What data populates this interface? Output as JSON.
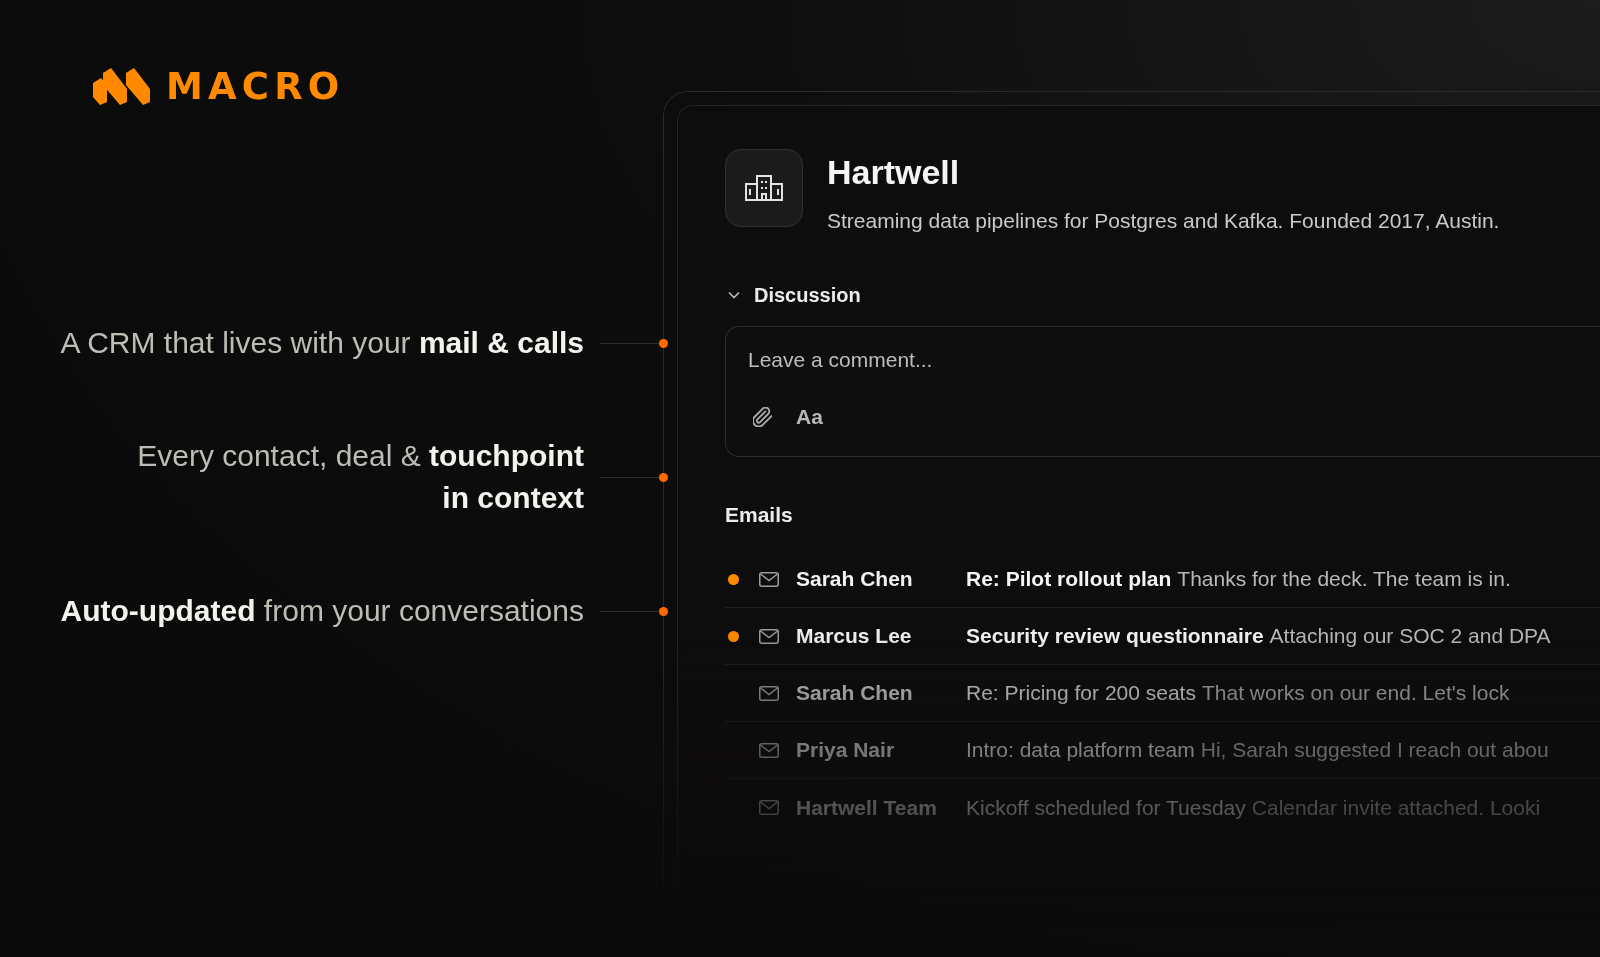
{
  "logo": {
    "text": "MACRO"
  },
  "taglines": [
    {
      "text": "A CRM that lives with your **mail & calls**"
    },
    {
      "text": "Every contact, deal & **touchpoint**\n**in context**"
    },
    {
      "text": "**Auto-updated** from your conversations"
    }
  ],
  "company": {
    "name": "Hartwell",
    "description": "Streaming data pipelines for Postgres and Kafka. Founded 2017, Austin."
  },
  "discussion": {
    "title": "Discussion",
    "expanded": true,
    "comment_box": {
      "placeholder": "Leave a comment...",
      "format_button": "Aa"
    }
  },
  "emails": {
    "title": "Emails",
    "rows": [
      {
        "sender": "Sarah Chen",
        "subject": "Re: Pilot rollout plan",
        "preview": "Thanks for the deck. The team is in.",
        "unread": true
      },
      {
        "sender": "Marcus Lee",
        "subject": "Security review questionnaire",
        "preview": "Attaching our SOC 2 and DPA",
        "unread": true
      },
      {
        "sender": "Sarah Chen",
        "subject": "Re: Pricing for 200 seats",
        "preview": "That works on our end. Let's lock",
        "unread": false
      },
      {
        "sender": "Priya Nair",
        "subject": "Intro: data platform team",
        "preview": "Hi, Sarah suggested I reach out abou",
        "unread": false
      },
      {
        "sender": "Hartwell Team",
        "subject": "Kickoff scheduled for Tuesday",
        "preview": "Calendar invite attached. Looki",
        "unread": false
      }
    ]
  }
}
